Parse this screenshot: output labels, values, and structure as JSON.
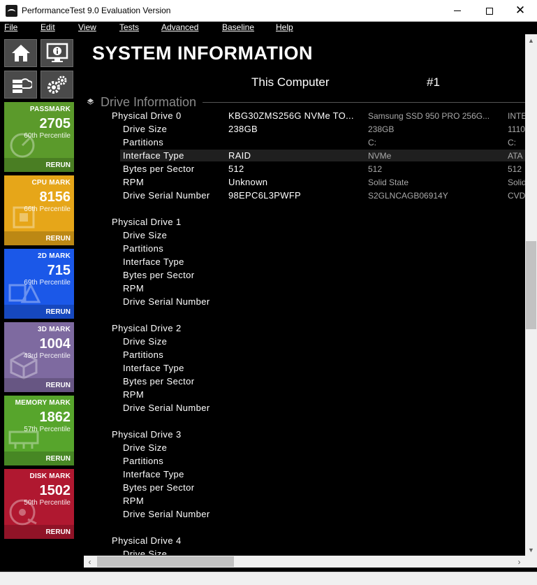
{
  "window": {
    "title": "PerformanceTest 9.0 Evaluation Version",
    "minimize_label": "—",
    "maximize_label": "☐",
    "close_label": "✕"
  },
  "menu": [
    "File",
    "Edit",
    "View",
    "Tests",
    "Advanced",
    "Baseline",
    "Help"
  ],
  "nav_icons": [
    "home-icon",
    "system-info-icon",
    "cloud-server-icon",
    "settings-icon"
  ],
  "tiles": [
    {
      "name": "PASSMARK",
      "score": "2705",
      "percentile": "60th Percentile",
      "rerun": "RERUN",
      "color": "#5b9a2b",
      "deco": "gauge-icon"
    },
    {
      "name": "CPU MARK",
      "score": "8156",
      "percentile": "66th Percentile",
      "rerun": "RERUN",
      "color": "#e6a619",
      "deco": "chip-icon"
    },
    {
      "name": "2D MARK",
      "score": "715",
      "percentile": "69th Percentile",
      "rerun": "RERUN",
      "color": "#1b58e8",
      "deco": "shapes-icon"
    },
    {
      "name": "3D MARK",
      "score": "1004",
      "percentile": "43rd Percentile",
      "rerun": "RERUN",
      "color": "#7e6aa0",
      "deco": "cube-icon"
    },
    {
      "name": "MEMORY MARK",
      "score": "1862",
      "percentile": "57th Percentile",
      "rerun": "RERUN",
      "color": "#57a52c",
      "deco": "memory-icon"
    },
    {
      "name": "DISK MARK",
      "score": "1502",
      "percentile": "50th Percentile",
      "rerun": "RERUN",
      "color": "#b01830",
      "deco": "disk-icon"
    }
  ],
  "page": {
    "title": "SYSTEM INFORMATION",
    "column_this_computer": "This Computer",
    "column_number": "#1",
    "section": "Drive Information"
  },
  "drive_fields": [
    "Drive Size",
    "Partitions",
    "Interface Type",
    "Bytes per Sector",
    "RPM",
    "Drive Serial Number"
  ],
  "drive0": {
    "label": "Physical Drive 0",
    "this": [
      "KBG30ZMS256G NVMe TO...",
      "238GB",
      "",
      "RAID",
      "512",
      "Unknown",
      "98EPC6L3PWFP"
    ],
    "c1": [
      "Samsung SSD 950 PRO 256G...",
      "238GB",
      "C:",
      "NVMe",
      "512",
      "Solid State",
      "S2GLNCAGB06914Y"
    ],
    "c2": [
      "INTE",
      "1110",
      "C:",
      "ATA",
      "512",
      "Solid",
      "CVD"
    ]
  },
  "drives": [
    {
      "label": "Physical Drive 1"
    },
    {
      "label": "Physical Drive 2"
    },
    {
      "label": "Physical Drive 3"
    },
    {
      "label": "Physical Drive 4",
      "partial": "Drive Size"
    }
  ],
  "scroll": {
    "up": "▲",
    "down": "▼",
    "left": "‹",
    "right": "›"
  }
}
